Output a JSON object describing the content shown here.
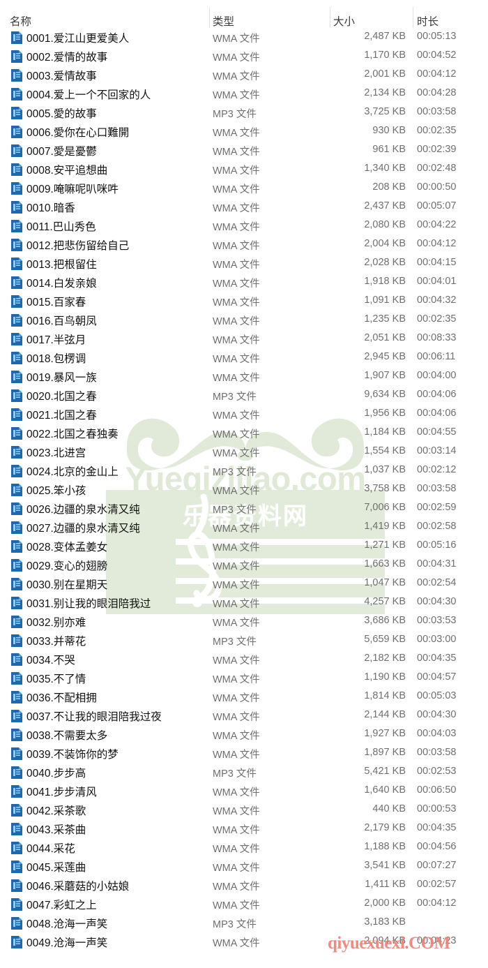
{
  "window": {
    "view": "details-list",
    "background_color": "#ffffff"
  },
  "columns": {
    "name": "名称",
    "type": "类型",
    "size": "大小",
    "duration": "时长"
  },
  "watermark": {
    "primary_text": "Yueqiziliao.com",
    "secondary_text": "乐器资料网",
    "primary_color": "#dfe9d6",
    "secondary_color": "#ffffff",
    "bottom_text": "qiyuexuexi.COM",
    "bottom_color": "#ef8278",
    "glyph": "treble-clef-icon"
  },
  "icons": {
    "file": "wma-file-icon",
    "file_color": "#1f68ad",
    "file_accent": "#7fc2ea"
  },
  "files": [
    {
      "name": "0001.爱江山更爱美人",
      "type": "WMA 文件",
      "size": "2,487 KB",
      "duration": "00:05:13"
    },
    {
      "name": "0002.爱情的故事",
      "type": "WMA 文件",
      "size": "1,170 KB",
      "duration": "00:04:52"
    },
    {
      "name": "0003.爱情故事",
      "type": "WMA 文件",
      "size": "2,001 KB",
      "duration": "00:04:12"
    },
    {
      "name": "0004.爱上一个不回家的人",
      "type": "WMA 文件",
      "size": "2,134 KB",
      "duration": "00:04:28"
    },
    {
      "name": "0005.愛的故事",
      "type": "MP3 文件",
      "size": "3,725 KB",
      "duration": "00:03:58"
    },
    {
      "name": "0006.愛你在心口難開",
      "type": "WMA 文件",
      "size": "930 KB",
      "duration": "00:02:35"
    },
    {
      "name": "0007.愛是憂鬱",
      "type": "WMA 文件",
      "size": "961 KB",
      "duration": "00:02:39"
    },
    {
      "name": "0008.安平追想曲",
      "type": "WMA 文件",
      "size": "1,340 KB",
      "duration": "00:02:48"
    },
    {
      "name": "0009.唵嘛呢叭咪吽",
      "type": "WMA 文件",
      "size": "208 KB",
      "duration": "00:00:50"
    },
    {
      "name": "0010.暗香",
      "type": "WMA 文件",
      "size": "2,437 KB",
      "duration": "00:05:07"
    },
    {
      "name": "0011.巴山秀色",
      "type": "WMA 文件",
      "size": "2,080 KB",
      "duration": "00:04:22"
    },
    {
      "name": "0012.把悲伤留给自己",
      "type": "WMA 文件",
      "size": "2,004 KB",
      "duration": "00:04:12"
    },
    {
      "name": "0013.把根留住",
      "type": "WMA 文件",
      "size": "2,028 KB",
      "duration": "00:04:15"
    },
    {
      "name": "0014.白发亲娘",
      "type": "WMA 文件",
      "size": "1,918 KB",
      "duration": "00:04:01"
    },
    {
      "name": "0015.百家春",
      "type": "WMA 文件",
      "size": "1,091 KB",
      "duration": "00:04:32"
    },
    {
      "name": "0016.百鸟朝凤",
      "type": "WMA 文件",
      "size": "1,235 KB",
      "duration": "00:02:35"
    },
    {
      "name": "0017.半弦月",
      "type": "WMA 文件",
      "size": "2,051 KB",
      "duration": "00:08:33"
    },
    {
      "name": "0018.包楞调",
      "type": "WMA 文件",
      "size": "2,945 KB",
      "duration": "00:06:11"
    },
    {
      "name": "0019.暴风一族",
      "type": "WMA 文件",
      "size": "1,907 KB",
      "duration": "00:04:00"
    },
    {
      "name": "0020.北国之春",
      "type": "MP3 文件",
      "size": "9,634 KB",
      "duration": "00:04:06"
    },
    {
      "name": "0021.北国之春",
      "type": "WMA 文件",
      "size": "1,956 KB",
      "duration": "00:04:06"
    },
    {
      "name": "0022.北国之春独奏",
      "type": "WMA 文件",
      "size": "1,184 KB",
      "duration": "00:04:55"
    },
    {
      "name": "0023.北进宫",
      "type": "WMA 文件",
      "size": "1,554 KB",
      "duration": "00:03:14"
    },
    {
      "name": "0024.北京的金山上",
      "type": "MP3 文件",
      "size": "1,037 KB",
      "duration": "00:02:12"
    },
    {
      "name": "0025.笨小孩",
      "type": "WMA 文件",
      "size": "3,758 KB",
      "duration": "00:03:58"
    },
    {
      "name": "0026.边疆的泉水清又纯",
      "type": "MP3 文件",
      "size": "7,006 KB",
      "duration": "00:02:59"
    },
    {
      "name": "0027.边疆的泉水清又纯",
      "type": "WMA 文件",
      "size": "1,419 KB",
      "duration": "00:02:58"
    },
    {
      "name": "0028.变体孟姜女",
      "type": "WMA 文件",
      "size": "1,271 KB",
      "duration": "00:05:16"
    },
    {
      "name": "0029.变心的翅膀",
      "type": "WMA 文件",
      "size": "1,663 KB",
      "duration": "00:04:31"
    },
    {
      "name": "0030.别在星期天",
      "type": "WMA 文件",
      "size": "1,047 KB",
      "duration": "00:02:54"
    },
    {
      "name": "0031.别让我的眼泪陪我过",
      "type": "WMA 文件",
      "size": "4,257 KB",
      "duration": "00:04:30"
    },
    {
      "name": "0032.别亦难",
      "type": "WMA 文件",
      "size": "3,686 KB",
      "duration": "00:03:53"
    },
    {
      "name": "0033.并蒂花",
      "type": "MP3 文件",
      "size": "5,659 KB",
      "duration": "00:03:00"
    },
    {
      "name": "0034.不哭",
      "type": "WMA 文件",
      "size": "2,182 KB",
      "duration": "00:04:35"
    },
    {
      "name": "0035.不了情",
      "type": "WMA 文件",
      "size": "1,190 KB",
      "duration": "00:04:57"
    },
    {
      "name": "0036.不配相拥",
      "type": "WMA 文件",
      "size": "1,814 KB",
      "duration": "00:05:03"
    },
    {
      "name": "0037.不让我的眼泪陪我过夜",
      "type": "WMA 文件",
      "size": "2,144 KB",
      "duration": "00:04:30"
    },
    {
      "name": "0038.不需要太多",
      "type": "WMA 文件",
      "size": "1,927 KB",
      "duration": "00:04:03"
    },
    {
      "name": "0039.不装饰你的梦",
      "type": "WMA 文件",
      "size": "1,897 KB",
      "duration": "00:03:58"
    },
    {
      "name": "0040.步步高",
      "type": "MP3 文件",
      "size": "5,421 KB",
      "duration": "00:02:53"
    },
    {
      "name": "0041.步步清风",
      "type": "WMA 文件",
      "size": "1,640 KB",
      "duration": "00:06:50"
    },
    {
      "name": "0042.采茶歌",
      "type": "WMA 文件",
      "size": "440 KB",
      "duration": "00:00:53"
    },
    {
      "name": "0043.采茶曲",
      "type": "WMA 文件",
      "size": "2,179 KB",
      "duration": "00:04:35"
    },
    {
      "name": "0044.采花",
      "type": "WMA 文件",
      "size": "1,188 KB",
      "duration": "00:04:56"
    },
    {
      "name": "0045.采莲曲",
      "type": "WMA 文件",
      "size": "3,541 KB",
      "duration": "00:07:27"
    },
    {
      "name": "0046.采蘑菇的小姑娘",
      "type": "WMA 文件",
      "size": "1,411 KB",
      "duration": "00:02:57"
    },
    {
      "name": "0047.彩虹之上",
      "type": "WMA 文件",
      "size": "2,000 KB",
      "duration": "00:04:12"
    },
    {
      "name": "0048.沧海一声笑",
      "type": "MP3 文件",
      "size": "3,183 KB",
      "duration": ""
    },
    {
      "name": "0049.沧海一声笑",
      "type": "WMA 文件",
      "size": "2,094 KB",
      "duration": "00:04:23"
    }
  ]
}
